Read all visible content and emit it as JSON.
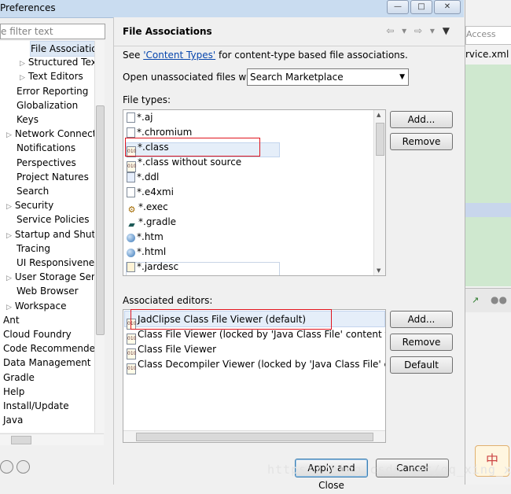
{
  "window": {
    "title": "Preferences",
    "buttons": [
      "—",
      "□",
      "✕"
    ]
  },
  "sidebar": {
    "filter_placeholder": "e filter text",
    "items": [
      {
        "label": "File Associatio",
        "indent": 2,
        "selected": true,
        "arrow": ""
      },
      {
        "label": "Structured Text",
        "indent": 2,
        "arrow": "▷"
      },
      {
        "label": "Text Editors",
        "indent": 2,
        "arrow": "▷"
      },
      {
        "label": "Error Reporting",
        "indent": 1,
        "arrow": ""
      },
      {
        "label": "Globalization",
        "indent": 1,
        "arrow": ""
      },
      {
        "label": "Keys",
        "indent": 1,
        "arrow": ""
      },
      {
        "label": "Network Connecti",
        "indent": 1,
        "arrow": "▷"
      },
      {
        "label": "Notifications",
        "indent": 1,
        "arrow": ""
      },
      {
        "label": "Perspectives",
        "indent": 1,
        "arrow": ""
      },
      {
        "label": "Project Natures",
        "indent": 1,
        "arrow": ""
      },
      {
        "label": "Search",
        "indent": 1,
        "arrow": ""
      },
      {
        "label": "Security",
        "indent": 1,
        "arrow": "▷"
      },
      {
        "label": "Service Policies",
        "indent": 1,
        "arrow": ""
      },
      {
        "label": "Startup and Shutd",
        "indent": 1,
        "arrow": "▷"
      },
      {
        "label": "Tracing",
        "indent": 1,
        "arrow": ""
      },
      {
        "label": "UI Responsiveness",
        "indent": 1,
        "arrow": ""
      },
      {
        "label": "User Storage Serv",
        "indent": 1,
        "arrow": "▷"
      },
      {
        "label": "Web Browser",
        "indent": 1,
        "arrow": ""
      },
      {
        "label": "Workspace",
        "indent": 1,
        "arrow": "▷"
      },
      {
        "label": "Ant",
        "indent": 0,
        "arrow": ""
      },
      {
        "label": "Cloud Foundry",
        "indent": 0,
        "arrow": ""
      },
      {
        "label": "Code Recommenders",
        "indent": 0,
        "arrow": ""
      },
      {
        "label": "Data Management",
        "indent": 0,
        "arrow": ""
      },
      {
        "label": "Gradle",
        "indent": 0,
        "arrow": ""
      },
      {
        "label": "Help",
        "indent": 0,
        "arrow": ""
      },
      {
        "label": "Install/Update",
        "indent": 0,
        "arrow": ""
      },
      {
        "label": "Java",
        "indent": 0,
        "arrow": ""
      }
    ]
  },
  "page": {
    "title": "File Associations",
    "nav": {
      "back": "⇦ ▾",
      "forward": "⇨ ▾",
      "menu": "▼"
    },
    "desc_prefix": "See ",
    "desc_link": "'Content Types'",
    "desc_suffix": " for content-type based file associations.",
    "open_label": "Open unassociated files with:",
    "open_value": "Search Marketplace",
    "file_types_label": "File types:",
    "file_types": [
      {
        "label": "*.aj",
        "icon": "file"
      },
      {
        "label": "*.chromium",
        "icon": "file"
      },
      {
        "label": "*.class",
        "icon": "class"
      },
      {
        "label": "*.class without source",
        "icon": "class"
      },
      {
        "label": "*.ddl",
        "icon": "ddl"
      },
      {
        "label": "*.e4xmi",
        "icon": "file"
      },
      {
        "label": "*.exec",
        "icon": "exec"
      },
      {
        "label": "*.gradle",
        "icon": "gradle"
      },
      {
        "label": "*.htm",
        "icon": "globe"
      },
      {
        "label": "*.html",
        "icon": "globe"
      },
      {
        "label": "*.jardesc",
        "icon": "jar"
      }
    ],
    "file_buttons": {
      "add": "Add...",
      "remove": "Remove"
    },
    "editors_label": "Associated editors:",
    "editors": [
      {
        "label": "JadClipse Class File Viewer (default)",
        "icon": "class"
      },
      {
        "label": "Class File Viewer (locked by 'Java Class File' content type)",
        "icon": "class"
      },
      {
        "label": "Class File Viewer",
        "icon": "class"
      },
      {
        "label": "Class Decompiler Viewer (locked by 'Java Class File' conter",
        "icon": "decompiler"
      }
    ],
    "editor_buttons": {
      "add": "Add...",
      "remove": "Remove",
      "default": "Default"
    },
    "apply_close": "Apply and Close",
    "cancel": "Cancel"
  },
  "background": {
    "access": "Access",
    "tab": "rvice.xml",
    "badge": "中"
  },
  "watermark": "https://blog.csdn.net/qq_xing_xin"
}
